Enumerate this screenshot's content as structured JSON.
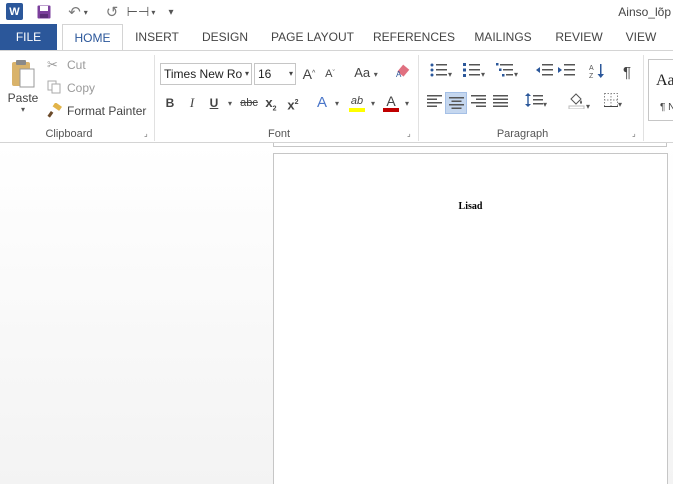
{
  "app": {
    "title": "Ainso_lõp"
  },
  "qat": {
    "word": "W",
    "save": "save-icon",
    "undo": "↶",
    "undo_dd": "▾",
    "redo": "↺",
    "touch": "⊢⊣",
    "touch_dd": "▾",
    "customize": "▾"
  },
  "tabs": {
    "file": "FILE",
    "home": "HOME",
    "insert": "INSERT",
    "design": "DESIGN",
    "page_layout": "PAGE LAYOUT",
    "references": "REFERENCES",
    "mailings": "MAILINGS",
    "review": "REVIEW",
    "view": "VIEW"
  },
  "clipboard": {
    "paste": "Paste",
    "cut": "Cut",
    "copy": "Copy",
    "format_painter": "Format Painter",
    "label": "Clipboard"
  },
  "font": {
    "name": "Times New Ro",
    "size": "16",
    "grow": "A",
    "shrink": "A",
    "change_case": "Aa",
    "bold": "B",
    "italic": "I",
    "underline": "U",
    "strike": "abc",
    "subscript": "x",
    "superscript": "x",
    "sub_mark": "2",
    "sup_mark": "2",
    "effects": "A",
    "highlight": "ab",
    "color": "A",
    "label": "Font"
  },
  "paragraph": {
    "pilcrow": "¶",
    "label": "Paragraph"
  },
  "styles": {
    "preview": "Aa",
    "name": "¶ N"
  },
  "document": {
    "heading": "Lisad"
  },
  "colors": {
    "accent": "#2b579a",
    "font_color": "#c00000",
    "highlight": "#ffff00"
  }
}
